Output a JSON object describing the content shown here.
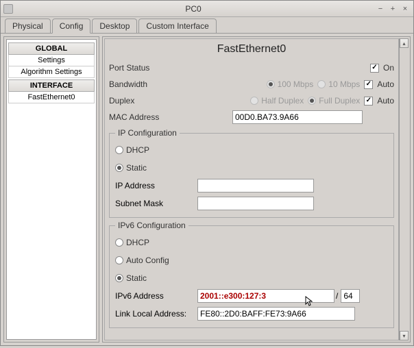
{
  "window": {
    "title": "PC0"
  },
  "tabs": [
    "Physical",
    "Config",
    "Desktop",
    "Custom Interface"
  ],
  "active_tab": "Config",
  "sidebar": {
    "sections": [
      {
        "header": "GLOBAL",
        "items": [
          "Settings",
          "Algorithm Settings"
        ]
      },
      {
        "header": "INTERFACE",
        "items": [
          "FastEthernet0"
        ]
      }
    ],
    "selected": "FastEthernet0"
  },
  "panel": {
    "title": "FastEthernet0",
    "port_status": {
      "label": "Port Status",
      "on_label": "On",
      "checked": true
    },
    "bandwidth": {
      "label": "Bandwidth",
      "opt1": "100 Mbps",
      "opt2": "10 Mbps",
      "selected": "100 Mbps",
      "auto_label": "Auto",
      "auto_checked": true
    },
    "duplex": {
      "label": "Duplex",
      "opt1": "Half Duplex",
      "opt2": "Full Duplex",
      "selected": "Full Duplex",
      "auto_label": "Auto",
      "auto_checked": true
    },
    "mac": {
      "label": "MAC Address",
      "value": "00D0.BA73.9A66"
    },
    "ipcfg": {
      "legend": "IP Configuration",
      "mode_dhcp": "DHCP",
      "mode_static": "Static",
      "mode": "Static",
      "ip_label": "IP Address",
      "ip_value": "",
      "subnet_label": "Subnet Mask",
      "subnet_value": ""
    },
    "ipv6cfg": {
      "legend": "IPv6 Configuration",
      "mode_dhcp": "DHCP",
      "mode_auto": "Auto Config",
      "mode_static": "Static",
      "mode": "Static",
      "addr_label": "IPv6 Address",
      "addr_value": "2001::e300:127:3",
      "prefix_value": "64",
      "ll_label": "Link Local Address:",
      "ll_value": "FE80::2D0:BAFF:FE73:9A66"
    }
  }
}
